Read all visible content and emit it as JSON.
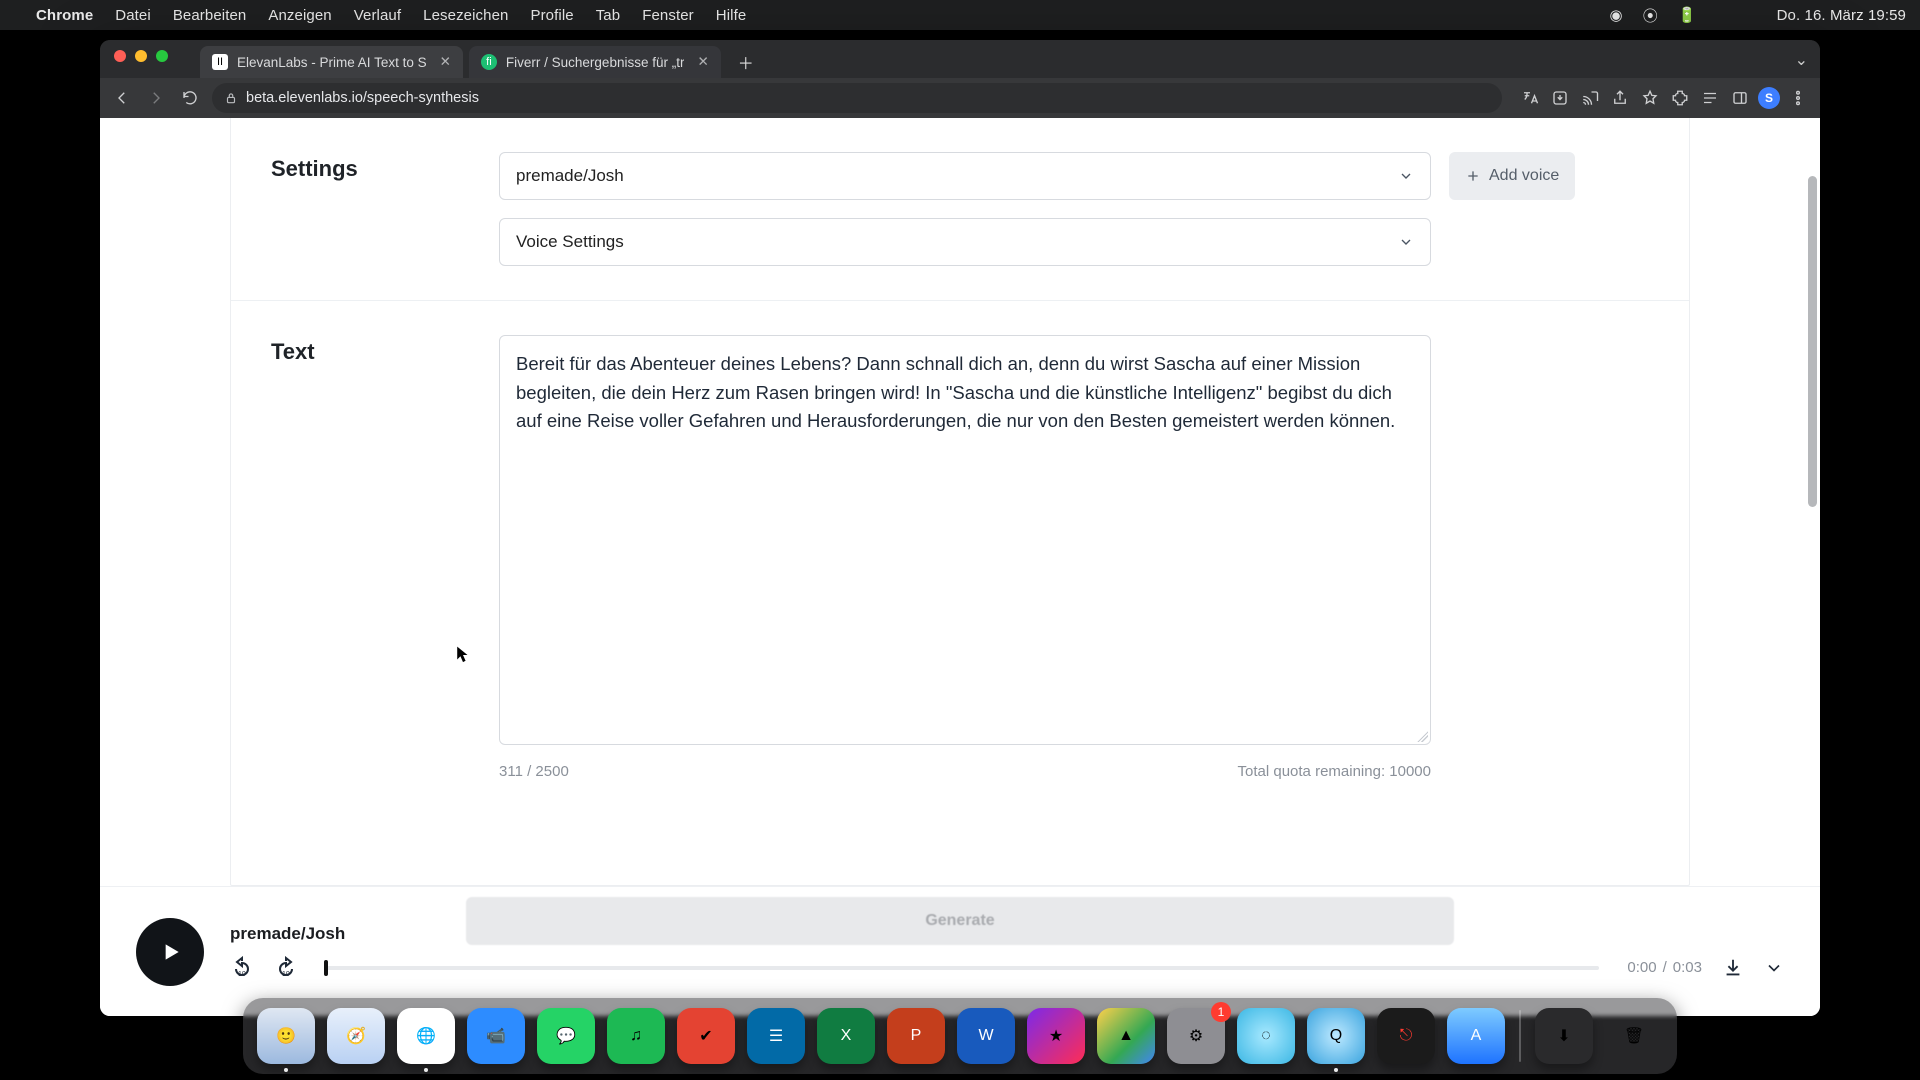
{
  "menubar": {
    "app": "Chrome",
    "items": [
      "Datei",
      "Bearbeiten",
      "Anzeigen",
      "Verlauf",
      "Lesezeichen",
      "Profile",
      "Tab",
      "Fenster",
      "Hilfe"
    ],
    "clock": "Do. 16. März  19:59"
  },
  "browser": {
    "tabs": [
      {
        "title": "ElevanLabs - Prime AI Text to S",
        "active": true
      },
      {
        "title": "Fiverr / Suchergebnisse für „tr",
        "active": false
      }
    ],
    "url": "beta.elevenlabs.io/speech-synthesis",
    "avatar_initial": "S"
  },
  "settings": {
    "heading": "Settings",
    "voice_label": "premade/Josh",
    "voice_settings_label": "Voice Settings",
    "add_voice_label": "Add voice"
  },
  "text": {
    "heading": "Text",
    "value": "Bereit für das Abenteuer deines Lebens? Dann schnall dich an, denn du wirst Sascha auf einer Mission begleiten, die dein Herz zum Rasen bringen wird! In \"Sascha und die künstliche Intelligenz\" begibst du dich auf eine Reise voller Gefahren und Herausforderungen, die nur von den Besten gemeistert werden können.",
    "count": "311 / 2500",
    "quota": "Total quota remaining: 10000"
  },
  "generate": {
    "label": "Generate"
  },
  "player": {
    "title": "premade/Josh",
    "current": "0:00",
    "sep": "/",
    "duration": "0:03"
  },
  "dock": {
    "badge": "1",
    "trash_label": "Trash"
  }
}
